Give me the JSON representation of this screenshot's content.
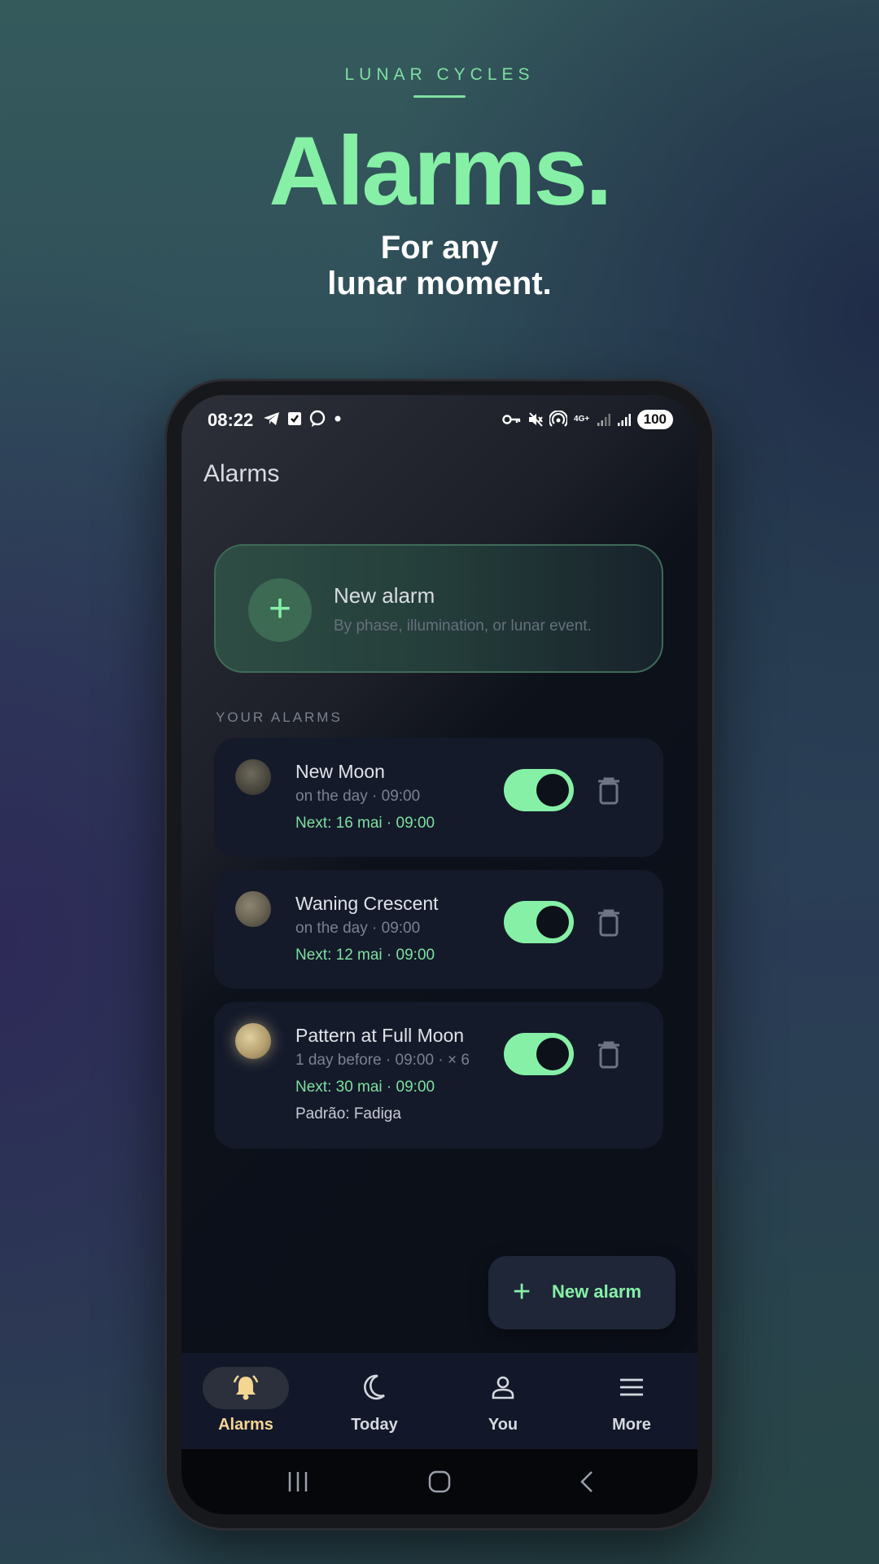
{
  "promo": {
    "eyebrow": "LUNAR CYCLES",
    "headline": "Alarms.",
    "subline_1": "For any",
    "subline_2": "lunar moment."
  },
  "status_bar": {
    "time": "08:22",
    "network": "4G+",
    "battery": "100"
  },
  "app": {
    "title": "Alarms"
  },
  "new_alarm_card": {
    "title": "New alarm",
    "subtitle": "By phase, illumination, or lunar event."
  },
  "alarms_section": {
    "heading": "YOUR ALARMS",
    "items": [
      {
        "name": "New Moon",
        "schedule": "on the day · 09:00",
        "next": "Next: 16 mai · 09:00",
        "pattern": "",
        "enabled": true,
        "moon_icon": "new-moon-icon"
      },
      {
        "name": "Waning Crescent",
        "schedule": "on the day · 09:00",
        "next": "Next: 12 mai · 09:00",
        "pattern": "",
        "enabled": true,
        "moon_icon": "waning-crescent-icon"
      },
      {
        "name": "Pattern at Full Moon",
        "schedule": "1 day before · 09:00 · × 6",
        "next": "Next: 30 mai · 09:00",
        "pattern": "Padrão: Fadiga",
        "enabled": true,
        "moon_icon": "full-moon-icon"
      }
    ]
  },
  "fab": {
    "label": "New alarm"
  },
  "bottom_nav": {
    "items": [
      {
        "label": "Alarms",
        "icon": "bell-icon",
        "active": true
      },
      {
        "label": "Today",
        "icon": "crescent-moon-icon",
        "active": false
      },
      {
        "label": "You",
        "icon": "person-icon",
        "active": false
      },
      {
        "label": "More",
        "icon": "menu-icon",
        "active": false
      }
    ]
  },
  "colors": {
    "accent": "#86f0a6",
    "active_nav": "#f4d592",
    "card_bg": "#141a2a",
    "screen_bg": "#0b0f18"
  }
}
